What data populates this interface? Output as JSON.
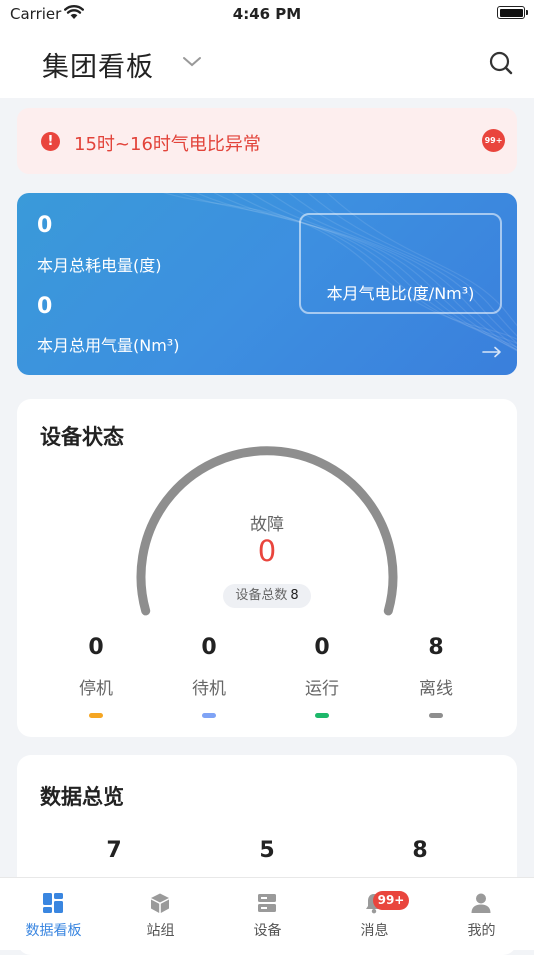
{
  "status_bar": {
    "carrier": "Carrier",
    "time": "4:46 PM"
  },
  "header": {
    "title": "集团看板"
  },
  "alert": {
    "icon_text": "!",
    "text": "15时~16时气电比异常",
    "badge": "99+",
    "accent": "#e9453d"
  },
  "energy": {
    "power_value": "0",
    "power_label": "本月总耗电量(度)",
    "gas_value": "0",
    "gas_label": "本月总用气量(Nm³)",
    "ratio_label": "本月气电比(度/Nm³)",
    "gradient_colors": [
      "#3a9ad9",
      "#3a7fdc"
    ]
  },
  "device_status": {
    "title": "设备状态",
    "fault_label": "故障",
    "fault_value": "0",
    "total_label": "设备总数",
    "total_value": "8",
    "stats": [
      {
        "value": "0",
        "label": "停机",
        "color": "#f5a623"
      },
      {
        "value": "0",
        "label": "待机",
        "color": "#7fa3f5"
      },
      {
        "value": "0",
        "label": "运行",
        "color": "#1db86a"
      },
      {
        "value": "8",
        "label": "离线",
        "color": "#8e8e8e"
      }
    ]
  },
  "overview": {
    "title": "数据总览",
    "items": [
      {
        "value": "7"
      },
      {
        "value": "5"
      },
      {
        "value": "8"
      }
    ]
  },
  "tabbar": {
    "items": [
      {
        "label": "数据看板",
        "icon": "dashboard-icon",
        "active": true
      },
      {
        "label": "站组",
        "icon": "cube-icon"
      },
      {
        "label": "设备",
        "icon": "server-icon"
      },
      {
        "label": "消息",
        "icon": "bell-icon",
        "badge": "99+"
      },
      {
        "label": "我的",
        "icon": "person-icon"
      }
    ],
    "active_color": "#3a86e0"
  }
}
